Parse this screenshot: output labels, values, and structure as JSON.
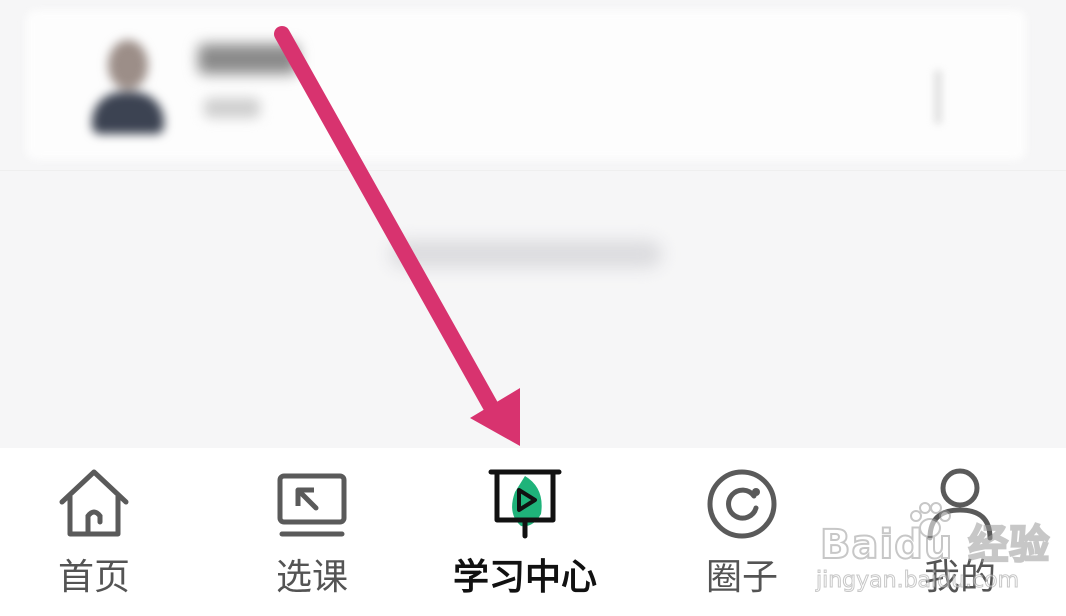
{
  "tabbar": {
    "active_index": 2,
    "items": [
      {
        "label": "首页",
        "icon": "home-icon"
      },
      {
        "label": "选课",
        "icon": "course-select-icon"
      },
      {
        "label": "学习中心",
        "icon": "learning-center-icon"
      },
      {
        "label": "圈子",
        "icon": "circle-icon"
      },
      {
        "label": "我的",
        "icon": "profile-icon"
      }
    ]
  },
  "annotation": {
    "arrow_color": "#d8336f"
  },
  "watermark": {
    "brand": "Baidu 经验",
    "site": "jingyan.baidu.com"
  },
  "colors": {
    "active_accent": "#1fb37a",
    "inactive_icon": "#5a5a5a",
    "active_text": "#111111"
  }
}
